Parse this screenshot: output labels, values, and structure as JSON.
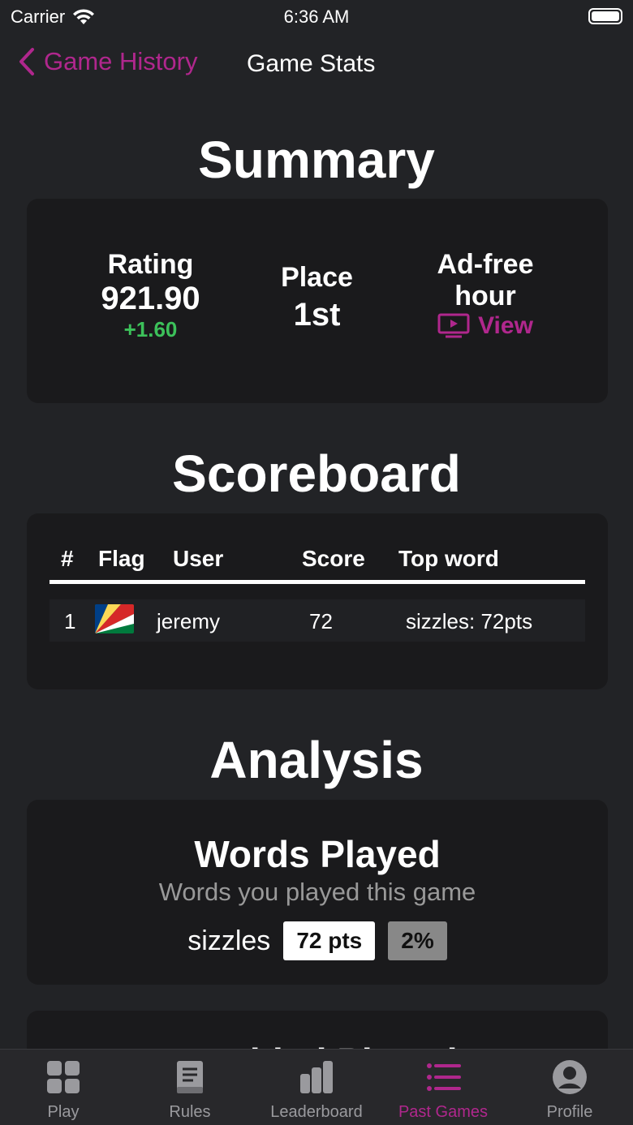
{
  "status_bar": {
    "carrier": "Carrier",
    "time": "6:36 AM"
  },
  "nav": {
    "back_label": "Game History",
    "title": "Game Stats"
  },
  "summary": {
    "title": "Summary",
    "rating_label": "Rating",
    "rating_value": "921.90",
    "rating_delta": "+1.60",
    "place_label": "Place",
    "place_value": "1st",
    "adfree_line1": "Ad-free",
    "adfree_line2": "hour",
    "view_label": "View"
  },
  "scoreboard": {
    "title": "Scoreboard",
    "columns": [
      "#",
      "Flag",
      "User",
      "Score",
      "Top word"
    ],
    "rows": [
      {
        "rank": "1",
        "flag": "seychelles-flag",
        "user": "jeremy",
        "score": "72",
        "top_word": "sizzles: 72pts"
      }
    ]
  },
  "analysis": {
    "title": "Analysis",
    "words_played_title": "Words Played",
    "words_played_subtitle": "Words you played this game",
    "words": [
      {
        "word": "sizzles",
        "points": "72 pts",
        "percent": "2%"
      }
    ],
    "next_card_title": "Doubled Played"
  },
  "tabs": [
    {
      "label": "Play",
      "icon": "grid-icon"
    },
    {
      "label": "Rules",
      "icon": "book-icon"
    },
    {
      "label": "Leaderboard",
      "icon": "bar-chart-icon"
    },
    {
      "label": "Past Games",
      "icon": "list-icon",
      "active": true
    },
    {
      "label": "Profile",
      "icon": "person-icon"
    }
  ],
  "colors": {
    "accent": "#b0278d",
    "positive": "#3cc15a",
    "background": "#222326",
    "card": "#1a1a1c"
  }
}
